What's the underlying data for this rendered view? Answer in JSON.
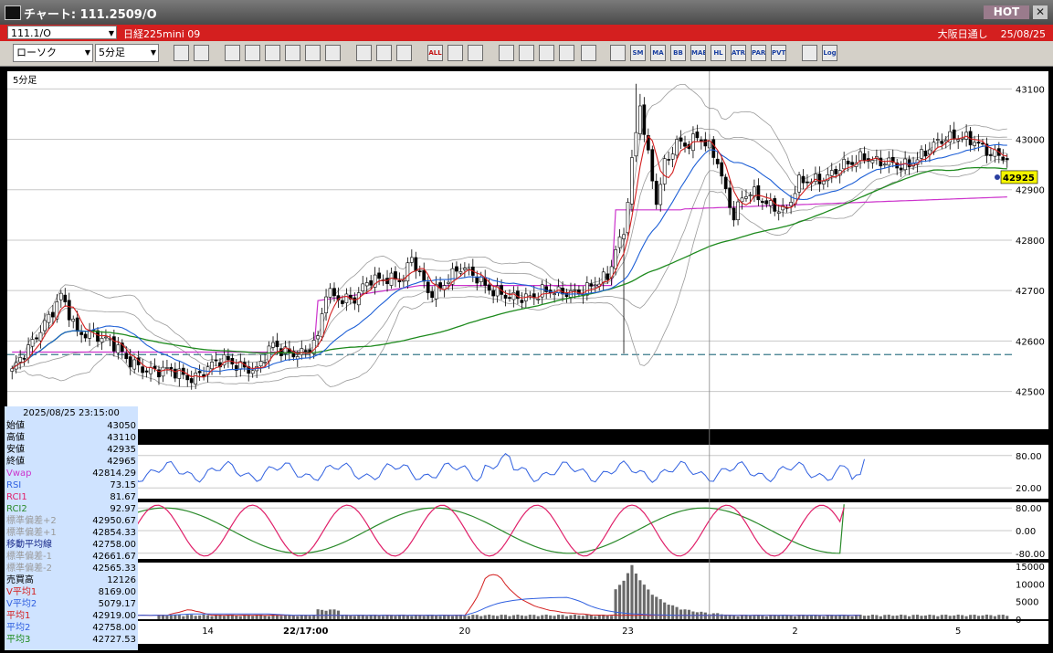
{
  "window": {
    "title": "チャート: 111.2509/O",
    "hot_label": "HOT",
    "close_label": "✕"
  },
  "symbol_bar": {
    "symbol": "111.1/O",
    "name": "日経225mini 09",
    "market": "大阪日通し",
    "date": "25/08/25"
  },
  "toolbar": {
    "chart_type": "ローソク",
    "timeframe": "5分足",
    "buttons": [
      "zoom",
      "layout",
      "pen",
      "line",
      "cursor",
      "paint",
      "note",
      "clipboard",
      "trash",
      "hline1",
      "hline2",
      "ALL",
      "tools",
      "config",
      "color",
      "import",
      "search",
      "compare",
      "bar",
      "ghost",
      "SMA",
      "MA",
      "BB",
      "MAE",
      "HL",
      "ATR",
      "PAR",
      "PVT",
      "box",
      "Log",
      "export"
    ]
  },
  "chart_data": {
    "type": "candlestick",
    "panel_label": "5分足",
    "price_ticks": [
      43100,
      43000,
      42900,
      42800,
      42700,
      42600,
      42500
    ],
    "price_ylim": [
      42425,
      43135
    ],
    "last_price_label": "42925",
    "last_price": 42925,
    "dashed_line_price": 42573,
    "x_labels": [
      {
        "label": "14",
        "idx": 48
      },
      {
        "label": "22/17:00",
        "idx": 72
      },
      {
        "label": "20",
        "idx": 111
      },
      {
        "label": "23",
        "idx": 151
      },
      {
        "label": "2",
        "idx": 192
      },
      {
        "label": "5",
        "idx": 232
      }
    ],
    "cursor_idx": 171,
    "candles_count": 245,
    "anchors": [
      [
        0,
        42540
      ],
      [
        4,
        42580
      ],
      [
        8,
        42640
      ],
      [
        12,
        42690
      ],
      [
        16,
        42610
      ],
      [
        20,
        42620
      ],
      [
        24,
        42600
      ],
      [
        28,
        42560
      ],
      [
        32,
        42550
      ],
      [
        36,
        42540
      ],
      [
        40,
        42535
      ],
      [
        44,
        42530
      ],
      [
        48,
        42545
      ],
      [
        52,
        42560
      ],
      [
        56,
        42555
      ],
      [
        60,
        42540
      ],
      [
        64,
        42590
      ],
      [
        68,
        42580
      ],
      [
        72,
        42575
      ],
      [
        75,
        42600
      ],
      [
        77,
        42700
      ],
      [
        80,
        42690
      ],
      [
        84,
        42680
      ],
      [
        88,
        42720
      ],
      [
        92,
        42730
      ],
      [
        96,
        42720
      ],
      [
        98,
        42760
      ],
      [
        102,
        42700
      ],
      [
        105,
        42710
      ],
      [
        110,
        42740
      ],
      [
        114,
        42730
      ],
      [
        118,
        42700
      ],
      [
        122,
        42680
      ],
      [
        126,
        42690
      ],
      [
        130,
        42700
      ],
      [
        134,
        42690
      ],
      [
        138,
        42700
      ],
      [
        142,
        42710
      ],
      [
        146,
        42720
      ],
      [
        148,
        42780
      ],
      [
        150,
        42820
      ],
      [
        152,
        42960
      ],
      [
        154,
        43070
      ],
      [
        156,
        42960
      ],
      [
        158,
        42870
      ],
      [
        160,
        42950
      ],
      [
        163,
        43000
      ],
      [
        166,
        42990
      ],
      [
        168,
        43000
      ],
      [
        171,
        42980
      ],
      [
        173,
        42960
      ],
      [
        175,
        42900
      ],
      [
        177,
        42850
      ],
      [
        179,
        42880
      ],
      [
        181,
        42890
      ],
      [
        184,
        42880
      ],
      [
        187,
        42870
      ],
      [
        190,
        42860
      ],
      [
        193,
        42910
      ],
      [
        196,
        42920
      ],
      [
        200,
        42930
      ],
      [
        203,
        42940
      ],
      [
        206,
        42950
      ],
      [
        209,
        42970
      ],
      [
        212,
        42960
      ],
      [
        215,
        42950
      ],
      [
        218,
        42940
      ],
      [
        221,
        42960
      ],
      [
        224,
        42980
      ],
      [
        227,
        42990
      ],
      [
        230,
        43000
      ],
      [
        233,
        43010
      ],
      [
        236,
        43000
      ],
      [
        238,
        42980
      ],
      [
        240,
        42965
      ]
    ],
    "ohlc_last": {
      "datetime": "2025/08/25 23:15:00",
      "open": 43050,
      "high": 43110,
      "low": 42935,
      "close": 42965
    },
    "rsi": {
      "ticks": [
        80,
        20
      ],
      "ylim": [
        0,
        100
      ],
      "last": 73.15
    },
    "rci": {
      "ticks": [
        80,
        0,
        -80
      ],
      "ylim": [
        -100,
        100
      ],
      "rci1": 81.67,
      "rci2": 92.97
    },
    "volume": {
      "ticks": [
        15000,
        10000,
        5000,
        0
      ],
      "ylim": [
        0,
        16000
      ]
    },
    "colors": {
      "up": "#ffffff",
      "down": "#000000",
      "grid": "#c8c8c8",
      "ma1": "#d42020",
      "ma2": "#1d5fd6",
      "ma3": "#1d8a1d",
      "vwap": "#cc33cc",
      "bb": "#9a9a9a",
      "rsi": "#3060e0",
      "rci1": "#e0206a",
      "rci2": "#2a8a2a",
      "volume": "#6a6a6a",
      "vol_ma1": "#d42020",
      "vol_ma2": "#3060e0",
      "last_price_bg": "#f5f500"
    }
  },
  "info_panel": {
    "datetime": "2025/08/25 23:15:00",
    "rows": [
      {
        "k": "始値",
        "v": "43050",
        "c": "#000000"
      },
      {
        "k": "高値",
        "v": "43110",
        "c": "#000000"
      },
      {
        "k": "安値",
        "v": "42935",
        "c": "#000000"
      },
      {
        "k": "終値",
        "v": "42965",
        "c": "#000000"
      },
      {
        "k": "Vwap",
        "v": "42814.29",
        "c": "#cc33cc"
      },
      {
        "k": "RSI",
        "v": "73.15",
        "c": "#3060e0"
      },
      {
        "k": "RCI1",
        "v": "81.67",
        "c": "#e0206a"
      },
      {
        "k": "RCI2",
        "v": "92.97",
        "c": "#2a8a2a"
      },
      {
        "k": "標準偏差+2",
        "v": "42950.67",
        "c": "#9a9a9a"
      },
      {
        "k": "標準偏差+1",
        "v": "42854.33",
        "c": "#9a9a9a"
      },
      {
        "k": "移動平均線",
        "v": "42758.00",
        "c": "#1a2a8a"
      },
      {
        "k": "標準偏差-1",
        "v": "42661.67",
        "c": "#9a9a9a"
      },
      {
        "k": "標準偏差-2",
        "v": "42565.33",
        "c": "#9a9a9a"
      },
      {
        "k": "売買高",
        "v": "12126",
        "c": "#000000"
      },
      {
        "k": "V平均1",
        "v": "8169.00",
        "c": "#d42020"
      },
      {
        "k": "V平均2",
        "v": "5079.17",
        "c": "#3060e0"
      },
      {
        "k": "平均1",
        "v": "42919.00",
        "c": "#d42020"
      },
      {
        "k": "平均2",
        "v": "42758.00",
        "c": "#3060e0"
      },
      {
        "k": "平均3",
        "v": "42727.53",
        "c": "#1d8a1d"
      }
    ]
  }
}
